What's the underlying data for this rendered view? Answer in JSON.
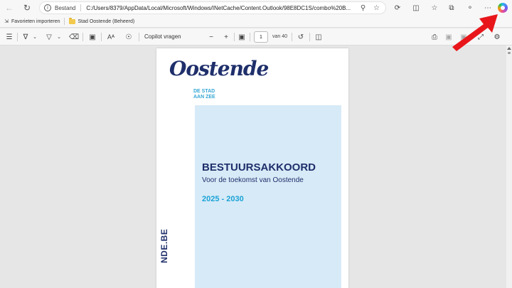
{
  "address_bar": {
    "site_label": "Bestand",
    "url": "C:/Users/8379/AppData/Local/Microsoft/Windows/INetCache/Content.Outlook/98E8DC1S/combo%20B..."
  },
  "favorites": {
    "import_label": "Favorieten importeren",
    "folder_label": "Stad Oostende (Beheerd)"
  },
  "pdf_toolbar": {
    "copilot_label": "Copilot vragen",
    "page_current": "1",
    "page_total_label": "van 40",
    "text_icon": "Aᴬ"
  },
  "document": {
    "logo_text": "Oostende",
    "tagline_line1": "DE STAD",
    "tagline_line2": "AAN ZEE",
    "side_url": "NDE.BE",
    "title": "BESTUURSAKKOORD",
    "subtitle": "Voor de toekomst van Oostende",
    "years": "2025 - 2030"
  },
  "colors": {
    "brand_navy": "#1f2f6b",
    "brand_cyan": "#1aa3d6",
    "panel_blue": "#d7eaf7",
    "annotation_arrow": "#e8161a"
  }
}
